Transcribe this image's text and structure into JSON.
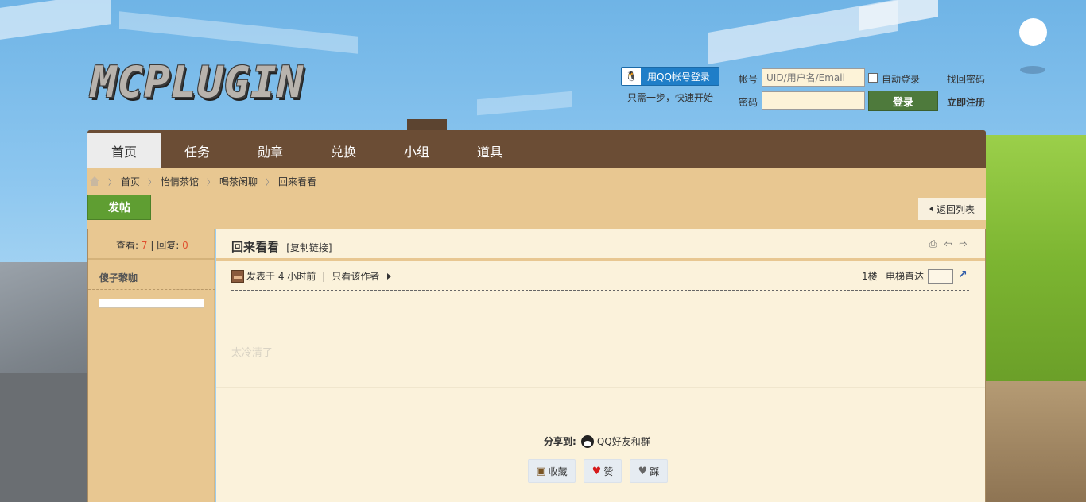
{
  "site": {
    "logo_text": "MCPLUGIN"
  },
  "login": {
    "qq_button": "用QQ帐号登录",
    "qq_subtext": "只需一步，快速开始",
    "account_label": "帐号",
    "account_placeholder": "UID/用户名/Email",
    "password_label": "密码",
    "remember_label": "自动登录",
    "login_button": "登录",
    "find_password": "找回密码",
    "register": "立即注册"
  },
  "nav": {
    "items": [
      "首页",
      "任务",
      "勋章",
      "兑换",
      "小组",
      "道具"
    ]
  },
  "breadcrumb": {
    "items": [
      "首页",
      "怡情茶馆",
      "喝茶闲聊",
      "回来看看"
    ]
  },
  "toolbar": {
    "post_button": "发帖",
    "back_button": "返回列表"
  },
  "thread": {
    "views_label": "查看:",
    "views": "7",
    "replies_label": "回复:",
    "replies": "0",
    "author": "傻子黎咖",
    "title": "回来看看",
    "copy_link": "[复制链接]",
    "posted": "发表于 4 小时前",
    "only_author": "只看该作者",
    "floor": "1楼",
    "elevator_label": "电梯直达",
    "content": "太冷清了",
    "share_label": "分享到:",
    "share_target": "QQ好友和群",
    "favorite": "收藏",
    "like": "赞",
    "dislike": "踩"
  }
}
